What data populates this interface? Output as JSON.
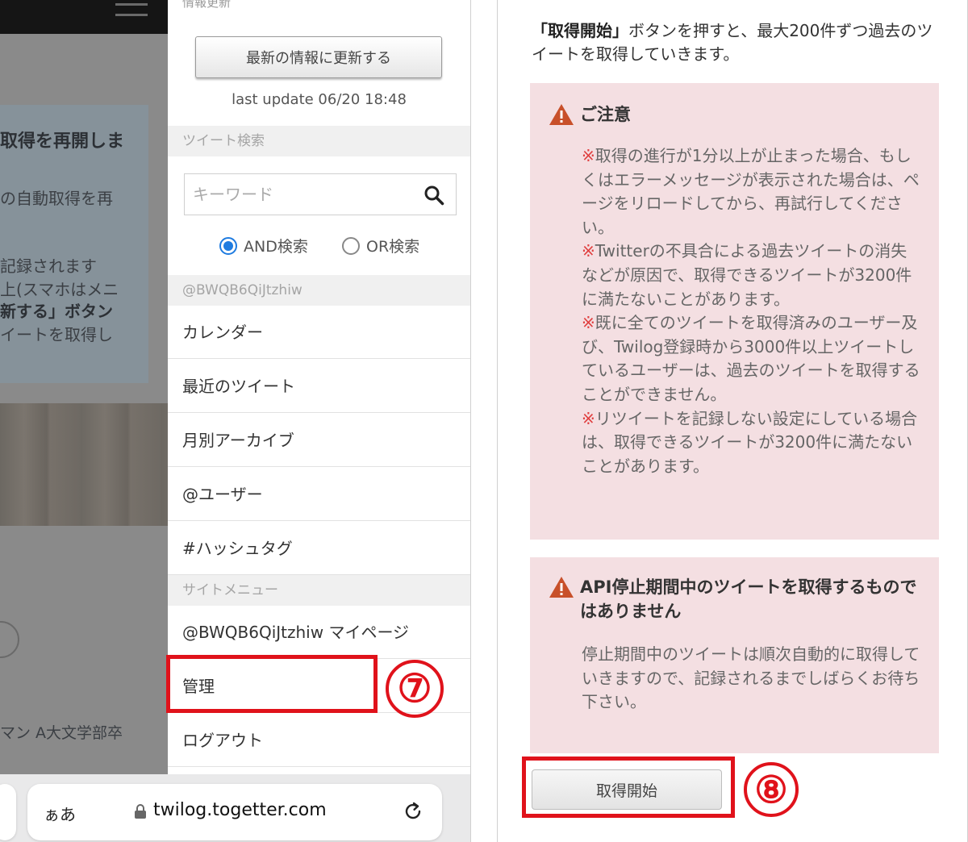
{
  "left_screen": {
    "background": {
      "card_title": "取得を再開しま",
      "card_lines": [
        "の自動取得を再",
        "記録されます",
        "上(スマホはメニ",
        "新する」ボタン",
        "イートを取得し"
      ],
      "profile_text": "マン A大文学部卒"
    },
    "menu": {
      "top_label": "情報更新",
      "refresh_button_label": "最新の情報に更新する",
      "last_update": "last update 06/20 18:48",
      "search_section_label": "ツイート検索",
      "search_placeholder": "キーワード",
      "search_mode_and": "AND検索",
      "search_mode_or": "OR検索",
      "selected_search_mode": "AND検索",
      "user_section_label": "@BWQB6QiJtzhiw",
      "user_items": [
        "カレンダー",
        "最近のツイート",
        "月別アーカイブ",
        "@ユーザー",
        "#ハッシュタグ"
      ],
      "site_section_label": "サイトメニュー",
      "site_items": [
        "@BWQB6QiJtzhiw マイページ",
        "管理",
        "ログアウト"
      ]
    },
    "annotation": "⑦",
    "url_bar": {
      "aa_label": "ぁあ",
      "url": "twilog.togetter.com"
    }
  },
  "right_screen": {
    "intro": {
      "strong": "「取得開始」",
      "rest": "ボタンを押すと、最大200件ずつ過去のツイートを取得していきます。"
    },
    "notice_1": {
      "title": "ご注意",
      "paragraphs": [
        {
          "mark": "※",
          "text": "取得の進行が1分以上が止まった場合、もしくはエラーメッセージが表示された場合は、ページをリロードしてから、再試行してください。"
        },
        {
          "mark": "※",
          "text": "Twitterの不具合による過去ツイートの消失などが原因で、取得できるツイートが3200件に満たないことがあります。"
        },
        {
          "mark": "※",
          "text": "既に全てのツイートを取得済みのユーザー及び、Twilog登録時から3000件以上ツイートしているユーザーは、過去のツイートを取得することができません。"
        },
        {
          "mark": "※",
          "text": "リツイートを記録しない設定にしている場合は、取得できるツイートが3200件に満たないことがあります。"
        }
      ]
    },
    "notice_2": {
      "title": "API停止期間中のツイートを取得するものではありません",
      "body": "停止期間中のツイートは順次自動的に取得していきますので、記録されるまでしばらくお待ち下さい。"
    },
    "start_button_label": "取得開始",
    "annotation": "⑧"
  },
  "colors": {
    "highlight": "#e0121b",
    "notice_background": "#f4dfe2",
    "warning_icon": "#c8502a",
    "radio_selected": "#1e7be0",
    "note_mark": "#e04040"
  }
}
